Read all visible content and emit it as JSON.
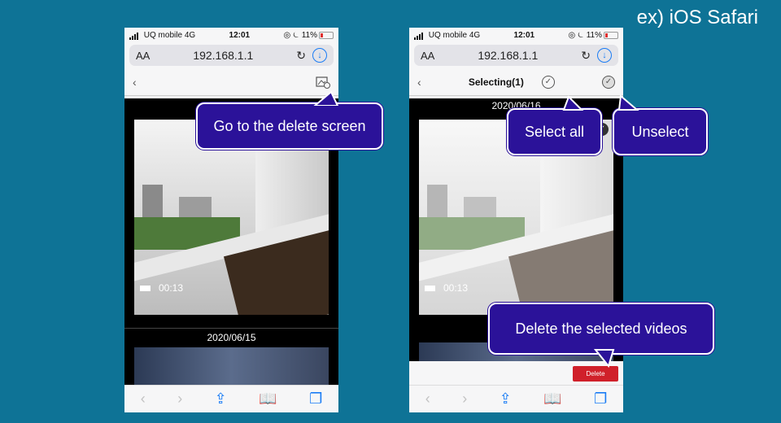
{
  "corner_title": "ex) iOS Safari",
  "status": {
    "carrier": "UQ mobile",
    "network": "4G",
    "time": "12:01",
    "battery": "11%"
  },
  "url": {
    "aa": "AA",
    "address": "192.168.1.1"
  },
  "left_phone": {
    "dates": [
      "2020/06/15"
    ],
    "video_duration": "00:13"
  },
  "right_phone": {
    "title": "Selecting(1)",
    "date_top": "2020/06/16",
    "video_duration": "00:13",
    "delete_label": "Delete"
  },
  "callouts": {
    "delete_screen": "Go to the delete screen",
    "select_all": "Select all",
    "unselect": "Unselect",
    "delete_selected": "Delete the selected videos"
  }
}
